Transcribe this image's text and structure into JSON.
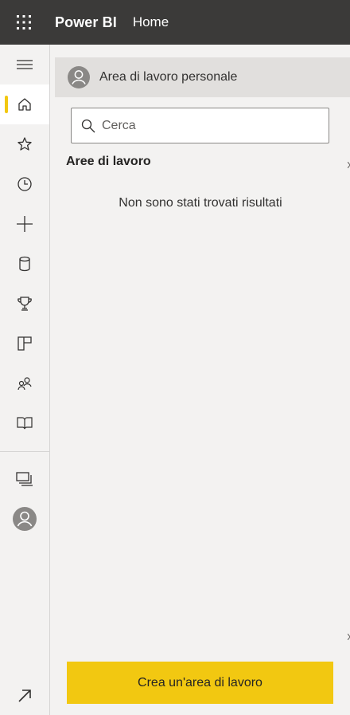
{
  "header": {
    "app_name": "Power BI",
    "breadcrumb": "Home"
  },
  "rail": {
    "items": [
      {
        "id": "menu",
        "icon": "hamburger-icon"
      },
      {
        "id": "home",
        "icon": "home-icon",
        "active": true
      },
      {
        "id": "favorites",
        "icon": "star-icon"
      },
      {
        "id": "recent",
        "icon": "clock-icon"
      },
      {
        "id": "create",
        "icon": "plus-icon"
      },
      {
        "id": "datasets",
        "icon": "cylinder-icon"
      },
      {
        "id": "goals",
        "icon": "trophy-icon"
      },
      {
        "id": "apps",
        "icon": "apps-icon"
      },
      {
        "id": "shared",
        "icon": "people-icon"
      },
      {
        "id": "learn",
        "icon": "book-icon"
      },
      {
        "id": "workspaces",
        "icon": "workspaces-icon"
      },
      {
        "id": "my-workspace",
        "icon": "avatar-icon"
      },
      {
        "id": "expand",
        "icon": "arrow-up-right-icon"
      }
    ]
  },
  "panel": {
    "personal_workspace": "Area di lavoro personale",
    "search": {
      "placeholder": "Cerca",
      "value": ""
    },
    "section_title": "Aree di lavoro",
    "empty_message": "Non sono stati trovati risultati",
    "create_button": "Crea un'area di lavoro"
  },
  "colors": {
    "topbar": "#3b3a39",
    "accent": "#f2c811",
    "background": "#f3f2f1",
    "selected_row": "#e1dfdd"
  }
}
